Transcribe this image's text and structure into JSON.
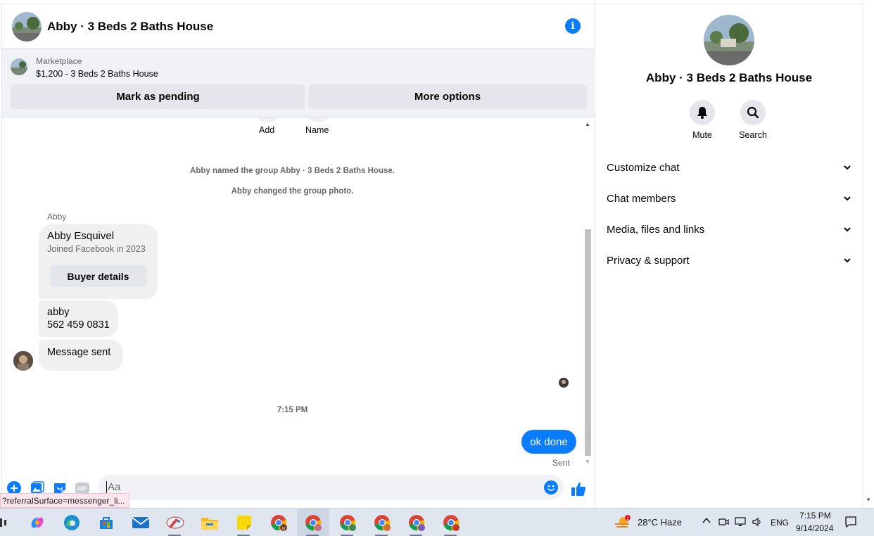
{
  "chat": {
    "title": "Abby · 3 Beds 2 Baths House",
    "marketplace": {
      "label": "Marketplace",
      "listing": "$1,200 - 3 Beds 2 Baths House",
      "mark_pending": "Mark as pending",
      "more_options": "More options"
    },
    "actions": {
      "add": "Add",
      "name": "Name"
    },
    "system_messages": [
      "Abby named the group Abby · 3 Beds 2 Baths House.",
      "Abby changed the group photo."
    ],
    "sender": "Abby",
    "buyer_card": {
      "name": "Abby Esquivel",
      "joined": "Joined Facebook in 2023",
      "button": "Buyer details"
    },
    "contact_message": {
      "line1": "abby",
      "line2": "562 459 0831"
    },
    "message_sent": "Message sent",
    "timestamp": "7:15 PM",
    "my_message": "ok done",
    "status": "Sent",
    "composer_placeholder": "Aa",
    "gif_label": "GIF"
  },
  "url_tooltip": "?referralSurface=messenger_li...",
  "panel": {
    "title": "Abby · 3 Beds 2 Baths House",
    "mute": "Mute",
    "search": "Search",
    "sections": [
      "Customize chat",
      "Chat members",
      "Media, files and links",
      "Privacy & support"
    ]
  },
  "taskbar": {
    "weather": "28°C  Haze",
    "weather_badge": "1",
    "language": "ENG",
    "time": "7:15 PM",
    "date": "9/14/2024",
    "chrome_profile_letter": "u"
  },
  "colors": {
    "accent": "#0a7cff",
    "bubble_gray": "#f0f0f0",
    "panel_gray": "#f0f2f5"
  },
  "icons": [
    "info-icon",
    "plus-icon",
    "image-icon",
    "sticker-icon",
    "gif-icon",
    "emoji-icon",
    "thumbs-up-icon",
    "bell-icon",
    "search-icon",
    "chevron-down-icon"
  ]
}
